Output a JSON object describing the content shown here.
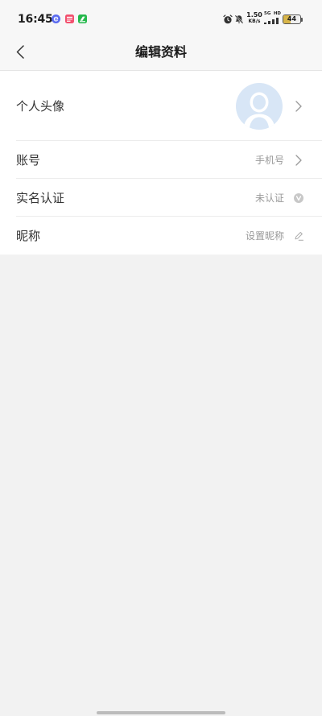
{
  "status_bar": {
    "time": "16:45",
    "notification_icons": [
      {
        "icon": "app-notification-icon",
        "color": "#5a6bf0"
      },
      {
        "icon": "app-notification-icon",
        "color": "#f2506e"
      },
      {
        "icon": "app-notification-icon",
        "color": "#26b84c"
      }
    ],
    "alarm_icon": "alarm-icon",
    "mute_icon": "bell-muted-icon",
    "network_speed": {
      "value": "1.50",
      "unit": "KB/s"
    },
    "network": {
      "type": "5G",
      "badge": "HD",
      "icon": "signal-icon"
    },
    "battery": {
      "level": "44",
      "icon": "battery-icon",
      "fill_color": "#d8b548"
    }
  },
  "header": {
    "back_icon": "chevron-left-icon",
    "title": "编辑资料"
  },
  "profile_rows": [
    {
      "label": "个人头像",
      "avatar_icon": "avatar-placeholder-icon",
      "trailing_icon": "chevron-right-icon"
    },
    {
      "label": "账号",
      "value": "手机号",
      "trailing_icon": "chevron-right-icon"
    },
    {
      "label": "实名认证",
      "value": "未认证",
      "trailing_icon": "verified-badge-icon"
    },
    {
      "label": "昵称",
      "value": "设置昵称",
      "trailing_icon": "edit-pencil-icon"
    }
  ],
  "theme": {
    "page_background": "#f2f2f2",
    "header_background": "#f7f7f7",
    "card_background": "#ffffff",
    "text_primary": "#333333",
    "text_secondary": "#999999",
    "divider": "#ececec",
    "avatar_background": "#d8e6f6"
  }
}
